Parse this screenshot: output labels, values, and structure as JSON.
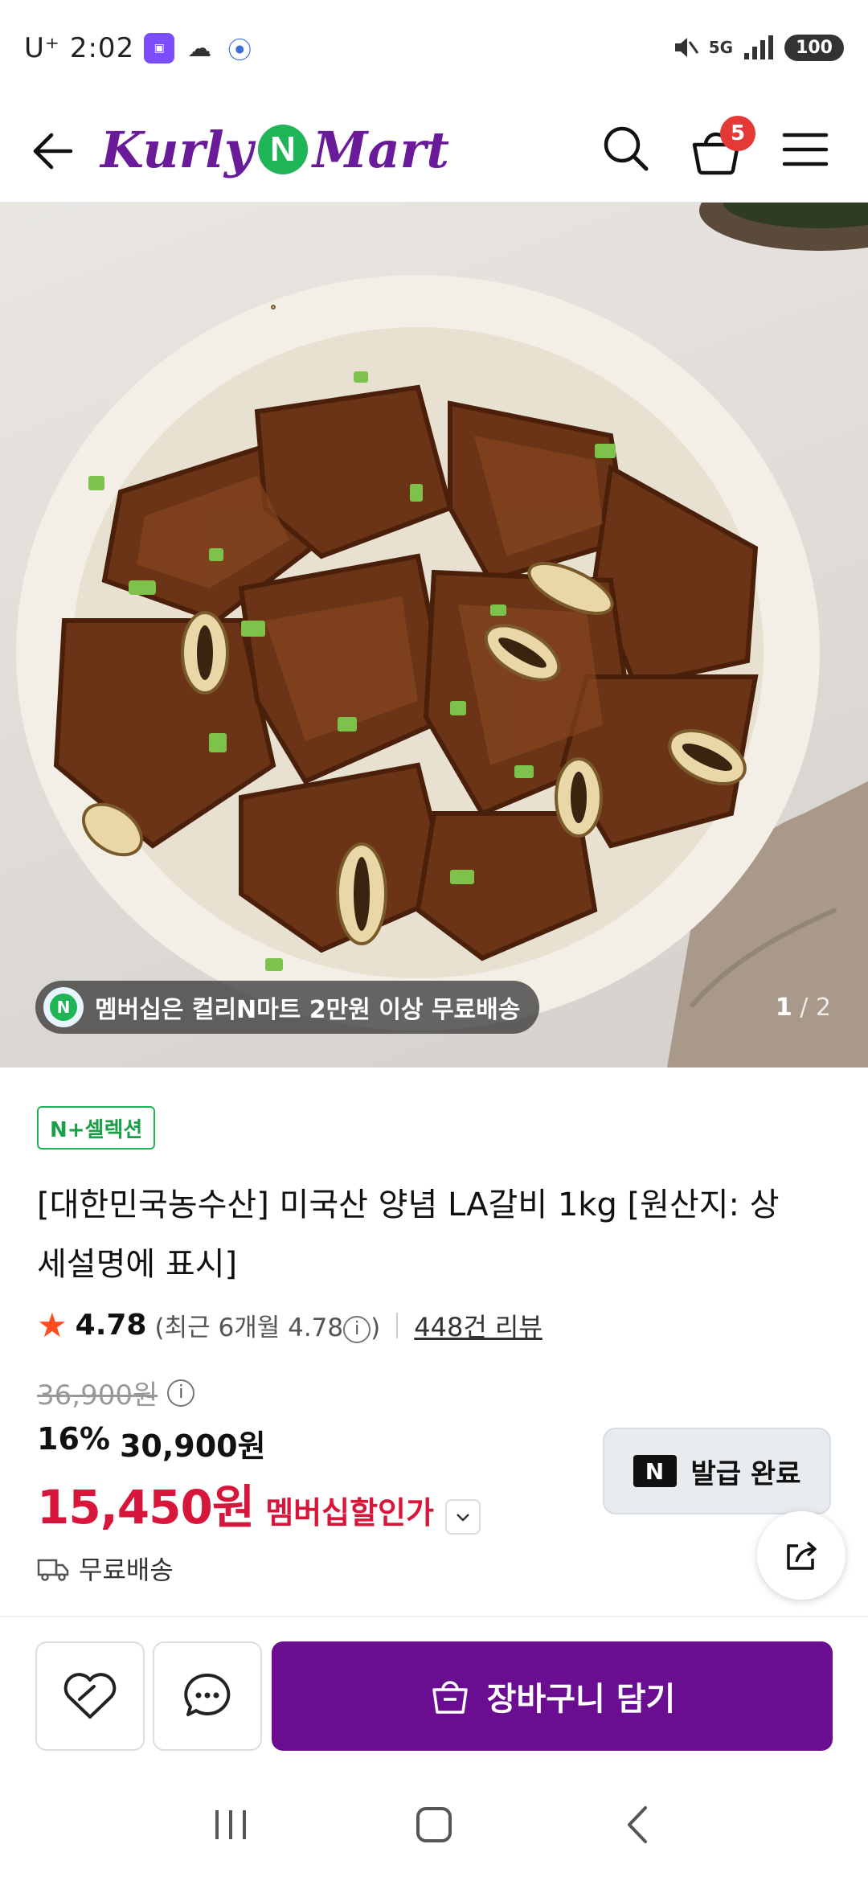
{
  "status_bar": {
    "carrier": "U⁺",
    "time": "2:02",
    "battery": "100",
    "network": "5G"
  },
  "header": {
    "logo_left": "Kurly",
    "logo_n": "N",
    "logo_right": "Mart",
    "cart_count": "5"
  },
  "gallery": {
    "promo_icon_letter": "N",
    "promo_text": "멤버십은 컬리N마트 2만원 이상 무료배송",
    "current_page": "1",
    "total_pages": "/ 2"
  },
  "product": {
    "selection_badge": "N+셀렉션",
    "title": "[대한민국농수산] 미국산 양념 LA갈비 1kg [원산지: 상세설명에 표시]",
    "rating": "4.78",
    "recent_rating_prefix": "(최근 6개월 4.78",
    "recent_rating_suffix": ")",
    "reviews": "448건 리뷰",
    "original_price": "36,900원",
    "discount_percent": "16%",
    "discount_price": "30,900원",
    "member_price": "15,450원",
    "member_label": "멤버십할인가",
    "shipping": "무료배송",
    "coupon_icon": "N",
    "coupon_label": "발급 완료"
  },
  "action_bar": {
    "add_to_cart_label": "장바구니 담기"
  },
  "colors": {
    "brand_purple": "#6a0d91",
    "brand_green": "#1fb556",
    "price_red": "#d6163a",
    "badge_red": "#e53935"
  }
}
